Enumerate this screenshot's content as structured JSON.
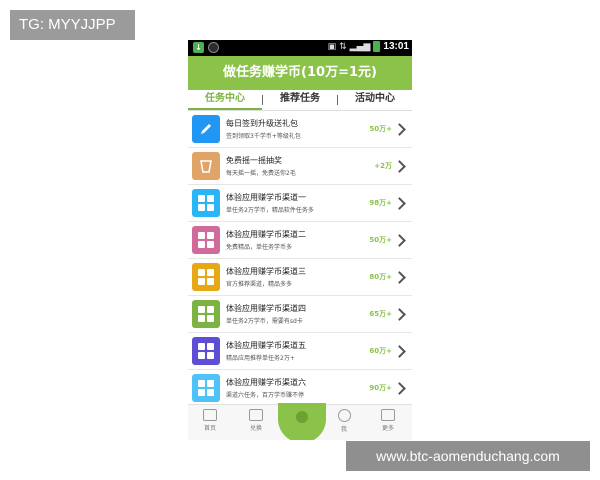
{
  "watermark_tag": "TG: MYYJJPP",
  "footer_url": "www.btc-aomenduchang.com",
  "status_bar": {
    "time": "13:01"
  },
  "title": "做任务赚学币(10万=1元)",
  "tabs": [
    {
      "label": "任务中心",
      "active": true
    },
    {
      "label": "推荐任务",
      "active": false
    },
    {
      "label": "活动中心",
      "active": false
    }
  ],
  "tasks": [
    {
      "title": "每日签到升级送礼包",
      "subtitle": "签到领取3千学币+等级礼包",
      "reward": "50万+",
      "icon": "pencil-icon",
      "color": "#2196f3"
    },
    {
      "title": "免费摇一摇抽奖",
      "subtitle": "每天摇一摇，免费送你2毛",
      "reward": "+2万",
      "icon": "cup-icon",
      "color": "#e0a466"
    },
    {
      "title": "体验应用赚学币渠道一",
      "subtitle": "单任务2万学币，精品软件任务多",
      "reward": "98万+",
      "icon": "app-grid-icon",
      "color": "#29b6f6"
    },
    {
      "title": "体验应用赚学币渠道二",
      "subtitle": "免费精品，单任务学币多",
      "reward": "50万+",
      "icon": "app-grid-icon",
      "color": "#d16b9b"
    },
    {
      "title": "体验应用赚学币渠道三",
      "subtitle": "官方推荐渠道，精品多多",
      "reward": "80万+",
      "icon": "app-grid-icon",
      "color": "#e6a817"
    },
    {
      "title": "体验应用赚学币渠道四",
      "subtitle": "单任务2万学币，需要有sd卡",
      "reward": "65万+",
      "icon": "app-grid-icon",
      "color": "#7cb342"
    },
    {
      "title": "体验应用赚学币渠道五",
      "subtitle": "精品应用推荐单任务2万+",
      "reward": "60万+",
      "icon": "app-grid-icon",
      "color": "#5c4fd6"
    },
    {
      "title": "体验应用赚学币渠道六",
      "subtitle": "渠道六任务，百万学币赚不停",
      "reward": "90万+",
      "icon": "app-grid-icon",
      "color": "#4fc3f7"
    }
  ],
  "bottom_nav": [
    {
      "label": "首页",
      "icon": "home-icon"
    },
    {
      "label": "兑换",
      "icon": "gift-icon"
    },
    {
      "label": "我",
      "icon": "user-icon"
    },
    {
      "label": "更多",
      "icon": "more-icon"
    }
  ]
}
